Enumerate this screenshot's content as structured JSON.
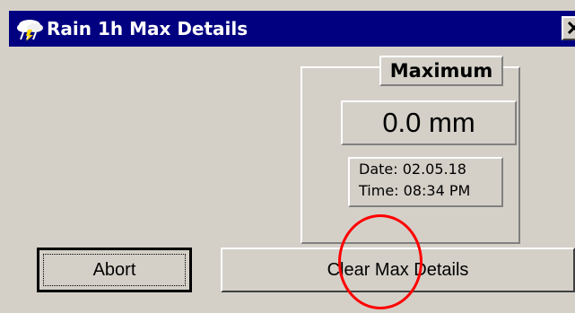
{
  "window": {
    "title": "Rain 1h Max Details",
    "icon": "rain-cloud-icon",
    "close_symbol": "close-icon"
  },
  "maximum": {
    "label": "Maximum",
    "value": "0.0 mm",
    "date_text": "Date: 02.05.18",
    "time_text": "Time: 08:34 PM"
  },
  "buttons": {
    "abort_label": "Abort",
    "clear_label": "Clear Max Details"
  },
  "annotation": {
    "marker_color": "#ff0000"
  },
  "colors": {
    "titlebar": "#000080",
    "face": "#d4d0c8"
  }
}
